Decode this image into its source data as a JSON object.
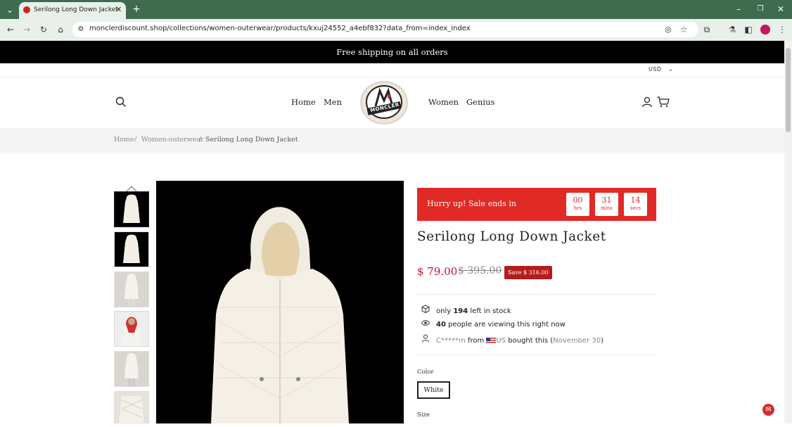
{
  "browser": {
    "tab_title": "Serilong Long Down Jacket",
    "url": "monclerdiscount.shop/collections/women-outerwear/products/kxuj24552_a4ebf832?data_from=index_index"
  },
  "announcement": "Free shipping on all orders",
  "currency": "USD",
  "nav": {
    "home": "Home",
    "men": "Men",
    "women": "Women",
    "genius": "Genius"
  },
  "logo_text": "MONCLER",
  "breadcrumb": {
    "home": "Home",
    "sep": "/",
    "category": "Women-outerwear",
    "product": "Serilong Long Down Jacket"
  },
  "promo": {
    "text": "Hurry up!  Sale ends in",
    "hours": "00",
    "hours_label": "hrs",
    "minutes": "31",
    "minutes_label": "mins",
    "seconds": "14",
    "seconds_label": "secs"
  },
  "product": {
    "title": "Serilong Long Down Jacket",
    "price": "$ 79.00",
    "compare_price": "$ 395.00",
    "save": "Save $ 316.00"
  },
  "stock": {
    "pre": "only",
    "count": "194",
    "post": "left in stock"
  },
  "viewers": {
    "count": "40",
    "post": "people are viewing this right now"
  },
  "recent": {
    "name": "C*****m",
    "from": "from",
    "country": "US",
    "mid": "bought this (",
    "date": "November 30",
    "end": ")"
  },
  "options": {
    "color_label": "Color",
    "color_value": "White",
    "size_label": "Size"
  },
  "colors": {
    "accent": "#e12a26",
    "price": "#c8102e",
    "chrome": "#3f6b4f"
  }
}
